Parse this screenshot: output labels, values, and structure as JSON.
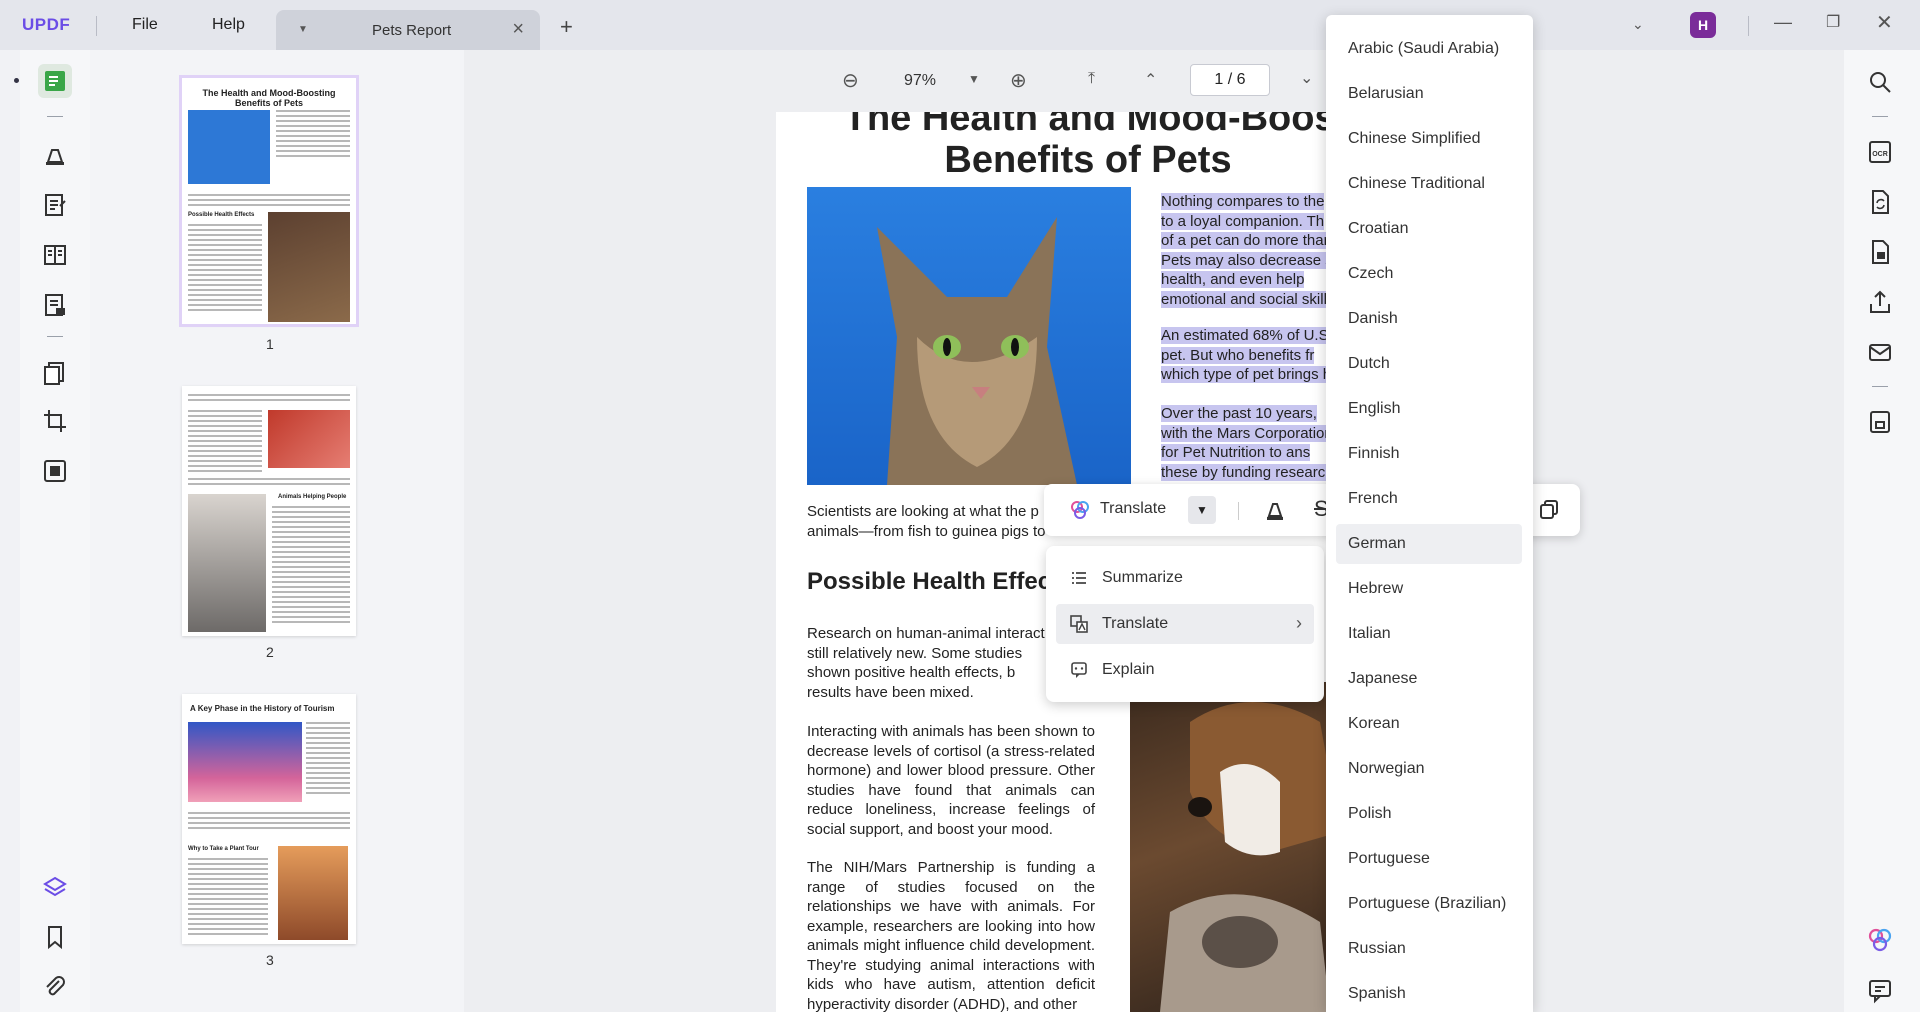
{
  "app": {
    "logo": "UPDF",
    "menu": [
      "File",
      "Help"
    ],
    "tab_title": "Pets Report",
    "avatar": "H"
  },
  "toolbar": {
    "zoom": "97%",
    "page_current": "1",
    "page_total": "6",
    "page_display": "1 / 6"
  },
  "thumbnails": {
    "pages": [
      {
        "num": "1",
        "title": "The Health and Mood-Boosting Benefits of Pets",
        "section": "Possible Health Effects"
      },
      {
        "num": "2",
        "section": "Animals Helping People"
      },
      {
        "num": "3",
        "title": "A Key Phase in the History of Tourism",
        "section": "Why to Take a Plant Tour"
      }
    ]
  },
  "document": {
    "title_line1": "The Health and Mood-Boost",
    "title_line2": "Benefits of Pets",
    "hl1": [
      "Nothing compares to the",
      "to a loyal companion. Th",
      "of a pet can do more than",
      "Pets may also decrease s",
      "health, and even help",
      "emotional and social skill"
    ],
    "hl2": [
      "An estimated 68% of U.S",
      "pet. But who benefits fr",
      "which type of pet brings h"
    ],
    "hl3": [
      "Over the past 10 years,",
      "with the Mars Corporation",
      "for Pet Nutrition to ans",
      "these by funding research"
    ],
    "scientists": [
      "Scientists are looking at what the p",
      "animals—from fish to guinea pigs to d"
    ],
    "heading": "Possible Health Effect",
    "p1": [
      "Research on human-animal interact",
      "still relatively new. Some studies",
      "shown positive health effects, b",
      "results have been mixed."
    ],
    "p2": "Interacting with animals has been shown to decrease levels of cortisol (a stress-related hormone) and lower blood pressure. Other studies have found that animals can reduce loneliness, increase feelings of social support, and boost your mood.",
    "p3": "The NIH/Mars Partnership is funding a range of studies focused on the relationships we have with animals. For example, researchers are looking into how animals might influence child development. They're studying animal interactions with kids who have autism, attention deficit hyperactivity disorder (ADHD), and other"
  },
  "float_toolbar": {
    "translate_label": "Translate"
  },
  "context_menu": {
    "items": [
      "Summarize",
      "Translate",
      "Explain"
    ]
  },
  "languages": {
    "items": [
      "Arabic (Saudi Arabia)",
      "Belarusian",
      "Chinese Simplified",
      "Chinese Traditional",
      "Croatian",
      "Czech",
      "Danish",
      "Dutch",
      "English",
      "Finnish",
      "French",
      "German",
      "Hebrew",
      "Italian",
      "Japanese",
      "Korean",
      "Norwegian",
      "Polish",
      "Portuguese",
      "Portuguese (Brazilian)",
      "Russian",
      "Spanish"
    ],
    "selected": "German"
  },
  "colors": {
    "brand": "#6b4de6",
    "highlight": "#c7c5ef",
    "avatar": "#7a2c99"
  }
}
